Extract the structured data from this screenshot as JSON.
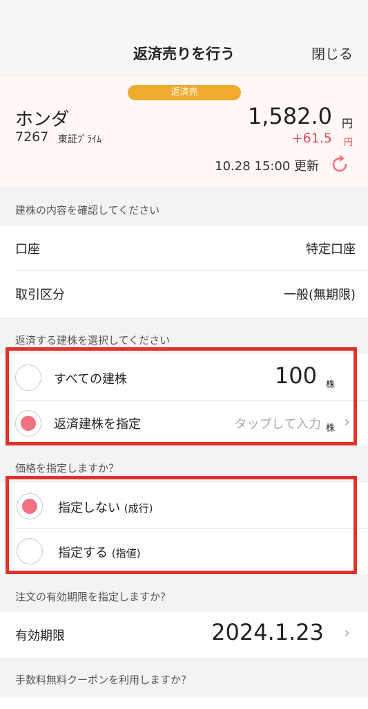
{
  "header": {
    "title": "返済売りを行う",
    "close_label": "閉じる"
  },
  "stock": {
    "badge": "返済売",
    "name": "ホンダ",
    "code": "7267",
    "market": "東証ﾌﾟﾗｲﾑ",
    "price": "1,582.0",
    "price_unit": "円",
    "change": "+61.5",
    "change_unit": "円",
    "updated": "10.28 15:00 更新",
    "refresh_icon": "refresh-icon",
    "badge_color": "#f0ab30",
    "change_color": "#e64c5a"
  },
  "position_section": {
    "label": "建株の内容を確認してください",
    "rows": [
      {
        "label": "口座",
        "value": "特定口座"
      },
      {
        "label": "取引区分",
        "value": "一般(無期限)"
      }
    ]
  },
  "select_section": {
    "label": "返済する建株を選択してください",
    "options": [
      {
        "label": "すべての建株",
        "value": "100",
        "unit": "株",
        "selected": false
      },
      {
        "label": "返済建株を指定",
        "value": "タップして入力",
        "unit": "株",
        "selected": true
      }
    ]
  },
  "price_section": {
    "label": "価格を指定しますか？",
    "options": [
      {
        "label": "指定しない",
        "sub": "(成行)",
        "selected": true
      },
      {
        "label": "指定する",
        "sub": "(指値)",
        "selected": false
      }
    ]
  },
  "expiry_section": {
    "label": "注文の有効期限を指定しますか？",
    "row_label": "有効期限",
    "value": "2024.1.23"
  },
  "coupon_section": {
    "label": "手数料無料クーポンを利用しますか？"
  },
  "colors": {
    "accent": "#f07282",
    "highlight_border": "#e0312a"
  }
}
